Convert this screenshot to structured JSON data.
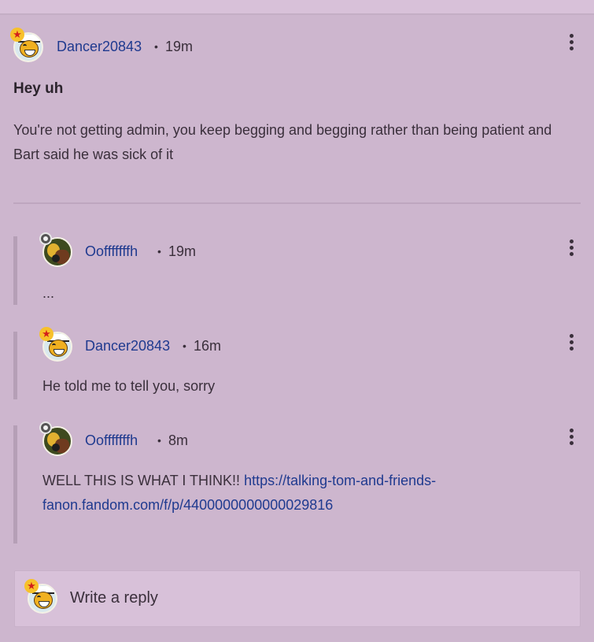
{
  "post": {
    "author": "Dancer20843",
    "separator": "•",
    "time": "19m",
    "title": "Hey uh",
    "body": "You're not getting admin, you keep begging and begging rather than being patient and Bart said he was sick of it"
  },
  "replies": [
    {
      "author": "Oofffffffh",
      "separator": "•",
      "time": "19m",
      "text": "..."
    },
    {
      "author": "Dancer20843",
      "separator": "•",
      "time": "16m",
      "text": "He told me to tell you, sorry"
    },
    {
      "author": "Oofffffffh",
      "separator": "•",
      "time": "8m",
      "text": "WELL THIS IS WHAT I THINK!!",
      "link_part1": "https://talking-tom-and-friends-",
      "link_part2": "fanon.fandom.com/f/p/4400000000000029816"
    }
  ],
  "reply_input": {
    "placeholder": "Write a reply"
  },
  "icons": {
    "more": "more-vertical-icon",
    "star_badge": "star-badge-icon",
    "gear_badge": "gear-badge-icon"
  },
  "colors": {
    "background": "#cdb6ce",
    "username": "#1f3a8f",
    "badge_star": "#f7c12b"
  }
}
